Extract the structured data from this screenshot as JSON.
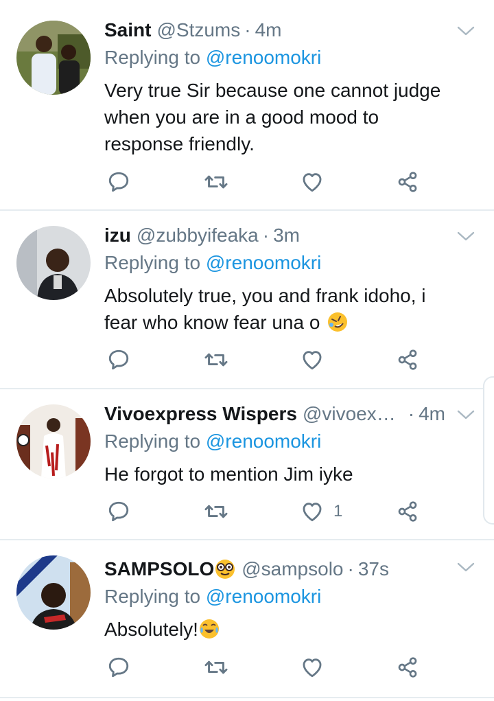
{
  "reply_prefix": "Replying to",
  "tweets": [
    {
      "name": "Saint",
      "handle": "@Stzums",
      "separator": "·",
      "time": "4m",
      "reply_to": "@renoomokri",
      "text_lines": [
        "Very true Sir because one cannot judge",
        "when you are in a good mood to",
        "response friendly."
      ],
      "like_count": ""
    },
    {
      "name": "izu",
      "handle": "@zubbyifeaka",
      "separator": "·",
      "time": "3m",
      "reply_to": "@renoomokri",
      "text_lines": [
        "Absolutely true, you and frank idoho, i",
        "fear who know fear una o"
      ],
      "like_count": ""
    },
    {
      "name": "Vivoexpress Wispers",
      "handle": "@vivoex…",
      "separator": "·",
      "time": "4m",
      "reply_to": "@renoomokri",
      "text_lines": [
        "He forgot to mention Jim iyke"
      ],
      "like_count": "1"
    },
    {
      "name": "SAMPSOLO",
      "handle": "@sampsolo",
      "separator": "·",
      "time": "37s",
      "reply_to": "@renoomokri",
      "text_lines": [
        "Absolutely!"
      ],
      "like_count": ""
    }
  ],
  "icons": {
    "reply": "reply-icon",
    "retweet": "retweet-icon",
    "like": "heart-icon",
    "share": "share-icon",
    "more": "chevron-down-icon"
  },
  "colors": {
    "link": "#1b95e0",
    "secondary": "#657786",
    "primary_text": "#14171a",
    "divider": "#e6ecf0"
  }
}
